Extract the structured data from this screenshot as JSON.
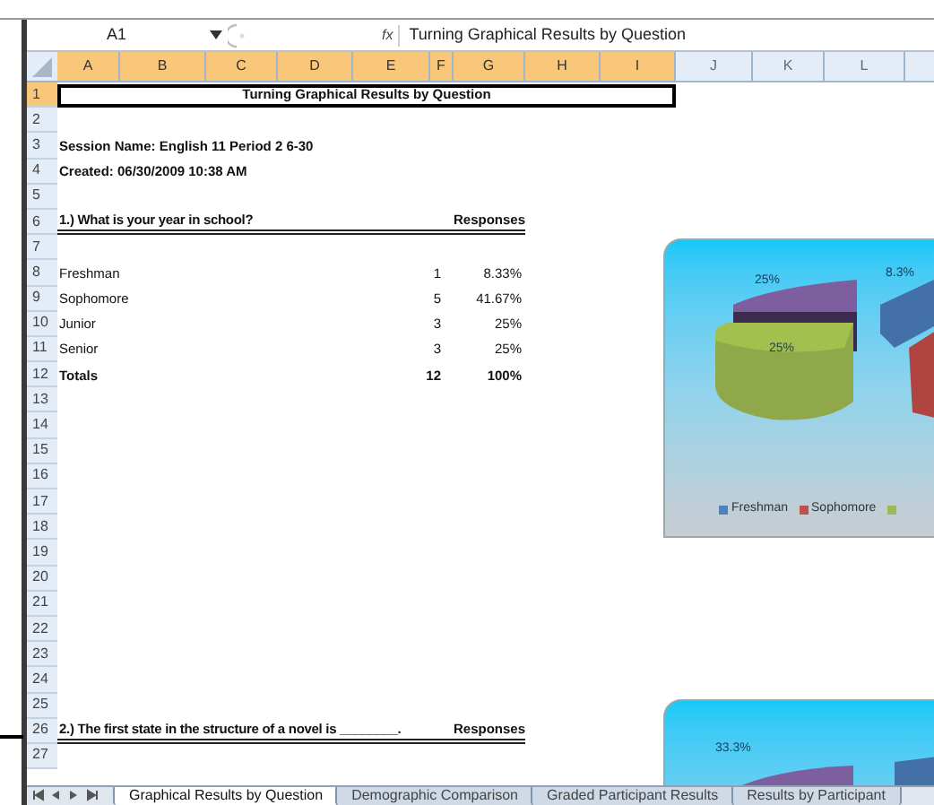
{
  "formula_bar": {
    "name_box": "A1",
    "function_label": "fx",
    "formula": "Turning Graphical Results by Question"
  },
  "columns": [
    {
      "label": "A",
      "selected": true
    },
    {
      "label": "B",
      "selected": true
    },
    {
      "label": "C",
      "selected": true
    },
    {
      "label": "D",
      "selected": true
    },
    {
      "label": "E",
      "selected": true
    },
    {
      "label": "F",
      "selected": true
    },
    {
      "label": "G",
      "selected": true
    },
    {
      "label": "H",
      "selected": true
    },
    {
      "label": "I",
      "selected": true
    },
    {
      "label": "J",
      "selected": false
    },
    {
      "label": "K",
      "selected": false
    },
    {
      "label": "L",
      "selected": false
    }
  ],
  "rows": [
    {
      "number": "1",
      "selected": true,
      "kind": "title",
      "text": "Turning Graphical Results by Question"
    },
    {
      "number": "2",
      "selected": false,
      "kind": "blank"
    },
    {
      "number": "3",
      "selected": false,
      "kind": "info",
      "text": "Session Name: English 11 Period 2 6-30"
    },
    {
      "number": "4",
      "selected": false,
      "kind": "info",
      "text": "Created: 06/30/2009 10:38 AM"
    },
    {
      "number": "5",
      "selected": false,
      "kind": "blank"
    },
    {
      "number": "6",
      "selected": false,
      "kind": "question",
      "text": "1.) What is your year in school?",
      "responses": "Responses"
    },
    {
      "number": "7",
      "selected": false,
      "kind": "blank"
    },
    {
      "number": "8",
      "selected": false,
      "kind": "answer",
      "label": "Freshman",
      "count": "1",
      "percent": "8.33%"
    },
    {
      "number": "9",
      "selected": false,
      "kind": "answer",
      "label": "Sophomore",
      "count": "5",
      "percent": "41.67%"
    },
    {
      "number": "10",
      "selected": false,
      "kind": "answer",
      "label": "Junior",
      "count": "3",
      "percent": "25%"
    },
    {
      "number": "11",
      "selected": false,
      "kind": "answer",
      "label": "Senior",
      "count": "3",
      "percent": "25%"
    },
    {
      "number": "12",
      "selected": false,
      "kind": "total",
      "label": "Totals",
      "count": "12",
      "percent": "100%"
    },
    {
      "number": "13",
      "selected": false,
      "kind": "blank"
    },
    {
      "number": "14",
      "selected": false,
      "kind": "blank"
    },
    {
      "number": "15",
      "selected": false,
      "kind": "blank"
    },
    {
      "number": "16",
      "selected": false,
      "kind": "blank"
    },
    {
      "number": "17",
      "selected": false,
      "kind": "blank"
    },
    {
      "number": "18",
      "selected": false,
      "kind": "blank"
    },
    {
      "number": "19",
      "selected": false,
      "kind": "blank"
    },
    {
      "number": "20",
      "selected": false,
      "kind": "blank"
    },
    {
      "number": "21",
      "selected": false,
      "kind": "blank"
    },
    {
      "number": "22",
      "selected": false,
      "kind": "blank"
    },
    {
      "number": "23",
      "selected": false,
      "kind": "blank"
    },
    {
      "number": "24",
      "selected": false,
      "kind": "blank"
    },
    {
      "number": "25",
      "selected": false,
      "kind": "blank"
    },
    {
      "number": "26",
      "selected": false,
      "kind": "question",
      "text": "2.) The first state in the structure of a novel is ________.",
      "responses": "Responses"
    },
    {
      "number": "27",
      "selected": false,
      "kind": "blank"
    }
  ],
  "charts": [
    {
      "data_labels": [
        "25%",
        "8.3%",
        "25%"
      ],
      "legend": [
        {
          "label": "Freshman",
          "color": "#4f81bd"
        },
        {
          "label": "Sophomore",
          "color": "#c0504d"
        },
        {
          "color": "#9bbb59"
        }
      ]
    },
    {
      "data_labels": [
        "33.3%"
      ]
    }
  ],
  "sheet_tabs": [
    {
      "label": "Graphical Results by Question",
      "selected": true
    },
    {
      "label": "Demographic Comparison",
      "selected": false
    },
    {
      "label": "Graded Participant Results",
      "selected": false
    },
    {
      "label": "Results by Participant",
      "selected": false
    }
  ]
}
